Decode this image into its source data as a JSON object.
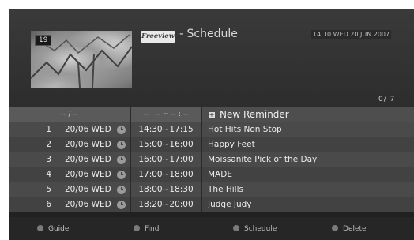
{
  "channel_number": "19",
  "logo_text": "Freeview",
  "title": "- Schedule",
  "clock": "14:10 WED 20 JUN 2007",
  "count": "0/ 7",
  "header": {
    "date_placeholder": "-- / --",
    "time_placeholder": "-- : -- ~ -- : --",
    "new_reminder": "New Reminder"
  },
  "rows": [
    {
      "num": "1",
      "date": "20/06 WED",
      "time": "14:30~17:15",
      "programme": "Hot Hits Non Stop"
    },
    {
      "num": "2",
      "date": "20/06 WED",
      "time": "15:00~16:00",
      "programme": "Happy Feet"
    },
    {
      "num": "3",
      "date": "20/06 WED",
      "time": "16:00~17:00",
      "programme": "Moissanite Pick of the Day"
    },
    {
      "num": "4",
      "date": "20/06 WED",
      "time": "17:00~18:00",
      "programme": "MADE"
    },
    {
      "num": "5",
      "date": "20/06 WED",
      "time": "18:00~18:30",
      "programme": "The Hills"
    },
    {
      "num": "6",
      "date": "20/06 WED",
      "time": "18:20~20:00",
      "programme": "Judge Judy"
    }
  ],
  "footer": {
    "guide": "Guide",
    "find": "Find",
    "schedule": "Schedule",
    "delete": "Delete"
  },
  "icons": {
    "reminder": "plus-icon",
    "clock": "clock-icon",
    "button": "color-dot-icon"
  }
}
